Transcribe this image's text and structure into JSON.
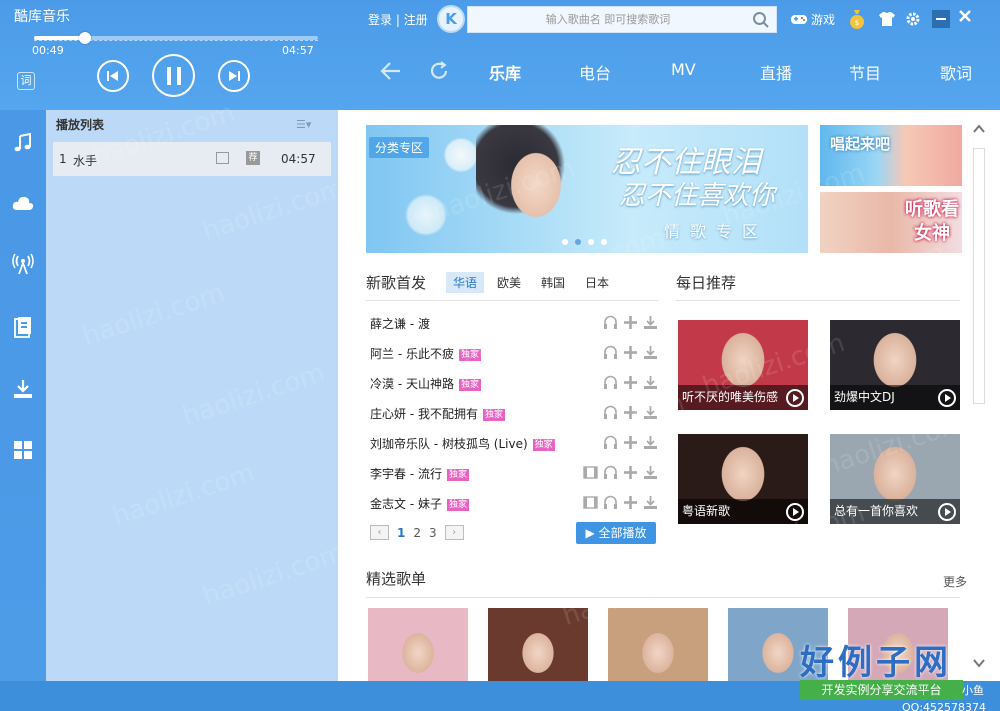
{
  "app": {
    "title": "酷库音乐"
  },
  "player": {
    "time_current": "00:49",
    "time_total": "04:57",
    "progress": 0.18,
    "lyric_icon_text": "词"
  },
  "account": {
    "login": "登录",
    "separator": "|",
    "register": "注册",
    "logo_letter": "K"
  },
  "search": {
    "placeholder": "输入歌曲名 即可搜索歌词"
  },
  "toolbar": {
    "game_label": "游戏"
  },
  "main_tabs": [
    {
      "label": "乐库",
      "active": true
    },
    {
      "label": "电台",
      "active": false
    },
    {
      "label": "MV",
      "active": false
    },
    {
      "label": "直播",
      "active": false
    },
    {
      "label": "节目",
      "active": false
    },
    {
      "label": "歌词",
      "active": false
    }
  ],
  "sidebar": {
    "items": [
      {
        "icon": "music-note-icon"
      },
      {
        "icon": "cloud-icon"
      },
      {
        "icon": "radio-icon"
      },
      {
        "icon": "library-icon"
      },
      {
        "icon": "download-icon"
      },
      {
        "icon": "apps-grid-icon"
      }
    ]
  },
  "playlist": {
    "header": "播放列表",
    "menu_glyph": "☰▾",
    "items": [
      {
        "index": "1",
        "name": "水手",
        "tag": "荐",
        "duration": "04:57"
      }
    ]
  },
  "banner": {
    "tag": "分类专区",
    "line1": "忍不住眼泪",
    "line2": "忍不住喜欢你",
    "subtitle": "情歌专区",
    "dots": 4,
    "active_dot": 1
  },
  "side_ads": [
    {
      "text": "唱起来吧"
    },
    {
      "text": "听歌看女神"
    }
  ],
  "new_songs": {
    "title": "新歌首发",
    "lang_tabs": [
      {
        "label": "华语",
        "active": true
      },
      {
        "label": "欧美",
        "active": false
      },
      {
        "label": "韩国",
        "active": false
      },
      {
        "label": "日本",
        "active": false
      }
    ],
    "exclusive_label": "独家",
    "songs": [
      {
        "name": "薛之谦 - 渡",
        "exclusive": false,
        "mv": false
      },
      {
        "name": "阿兰 - 乐此不疲",
        "exclusive": true,
        "mv": false
      },
      {
        "name": "冷漠 - 天山神路",
        "exclusive": true,
        "mv": false
      },
      {
        "name": "庄心妍 - 我不配拥有",
        "exclusive": true,
        "mv": false
      },
      {
        "name": "刘珈帝乐队 - 树枝孤鸟 (Live)",
        "exclusive": true,
        "mv": false
      },
      {
        "name": "李宇春 - 流行",
        "exclusive": true,
        "mv": true
      },
      {
        "name": "金志文 - 妹子",
        "exclusive": true,
        "mv": true
      }
    ],
    "pages": [
      "1",
      "2",
      "3"
    ],
    "active_page": "1",
    "prev_glyph": "‹",
    "next_glyph": "›",
    "play_all": "全部播放"
  },
  "daily": {
    "title": "每日推荐",
    "cards": [
      {
        "caption": "听不厌的唯美伤感",
        "bg": "#c23a4a"
      },
      {
        "caption": "劲爆中文DJ",
        "bg": "#2c2a30"
      },
      {
        "caption": "粤语新歌",
        "bg": "#2a1a18"
      },
      {
        "caption": "总有一首你喜欢",
        "bg": "#9aa6b0"
      }
    ]
  },
  "featured": {
    "title": "精选歌单",
    "more": "更多",
    "thumbs": [
      "#e8b9c4",
      "#6a3a2e",
      "#c9a07e",
      "#7fa6c9",
      "#d5a8b8"
    ]
  },
  "watermark": {
    "site_text": "haolizi.com",
    "logo": "好例子网",
    "slogan": "开发实例分享交流平台",
    "user": "小鱼",
    "qq": "QQ:452578374"
  },
  "colors": {
    "accent": "#3f95e4",
    "exclusive": "#e763c2",
    "panel": "#bcdaf8"
  }
}
